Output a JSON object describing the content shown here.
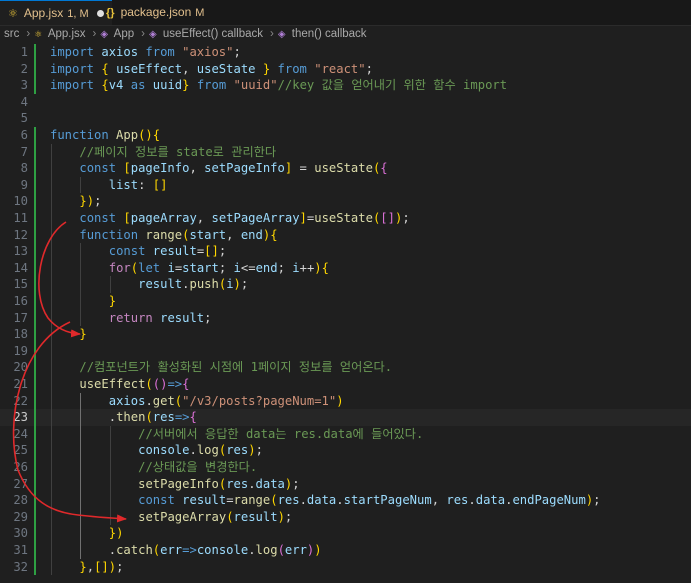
{
  "tabs": [
    {
      "label": "App.jsx",
      "status": "1, M",
      "active": true
    },
    {
      "label": "package.json",
      "status": "M",
      "active": false
    }
  ],
  "breadcrumb": [
    "src",
    "App.jsx",
    "App",
    "useEffect() callback",
    "then() callback"
  ],
  "colors": {
    "arrow": "#e0292b",
    "git_added": "#2ea043",
    "editor_bg": "#1f1f1f"
  },
  "editor": {
    "current_line": 23,
    "lines": [
      {
        "n": "1",
        "code": "import axios from \"axios\";"
      },
      {
        "n": "2",
        "code": "import { useEffect, useState } from \"react\";"
      },
      {
        "n": "3",
        "code": "import {v4 as uuid} from \"uuid\"//key 값을 얻어내기 위한 함수 import"
      },
      {
        "n": "4",
        "code": ""
      },
      {
        "n": "5",
        "code": ""
      },
      {
        "n": "6",
        "code": "function App(){"
      },
      {
        "n": "7",
        "code": "    //페이지 정보를 state로 관리한다"
      },
      {
        "n": "8",
        "code": "    const [pageInfo, setPageInfo] = useState({"
      },
      {
        "n": "9",
        "code": "        list: []"
      },
      {
        "n": "10",
        "code": "    });"
      },
      {
        "n": "11",
        "code": "    const [pageArray, setPageArray]=useState([]);"
      },
      {
        "n": "12",
        "code": "    function range(start, end){"
      },
      {
        "n": "13",
        "code": "        const result=[];"
      },
      {
        "n": "14",
        "code": "        for(let i=start; i<=end; i++){"
      },
      {
        "n": "15",
        "code": "            result.push(i);"
      },
      {
        "n": "16",
        "code": "        }"
      },
      {
        "n": "17",
        "code": "        return result;"
      },
      {
        "n": "18",
        "code": "    }"
      },
      {
        "n": "19",
        "code": ""
      },
      {
        "n": "20",
        "code": "    //컴포넌트가 활성화된 시점에 1페이지 정보를 얻어온다."
      },
      {
        "n": "21",
        "code": "    useEffect(()=>{"
      },
      {
        "n": "22",
        "code": "        axios.get(\"/v3/posts?pageNum=1\")"
      },
      {
        "n": "23",
        "code": "        .then(res=>{"
      },
      {
        "n": "24",
        "code": "            //서버에서 응답한 data는 res.data에 들어있다."
      },
      {
        "n": "25",
        "code": "            console.log(res);"
      },
      {
        "n": "26",
        "code": "            //상태값을 변경한다."
      },
      {
        "n": "27",
        "code": "            setPageInfo(res.data);"
      },
      {
        "n": "28",
        "code": "            const result=range(res.data.startPageNum, res.data.endPageNum);"
      },
      {
        "n": "29",
        "code": "            setPageArray(result);"
      },
      {
        "n": "30",
        "code": "        })"
      },
      {
        "n": "31",
        "code": "        .catch(err=>console.log(err))"
      },
      {
        "n": "32",
        "code": "    },[]);"
      }
    ]
  }
}
